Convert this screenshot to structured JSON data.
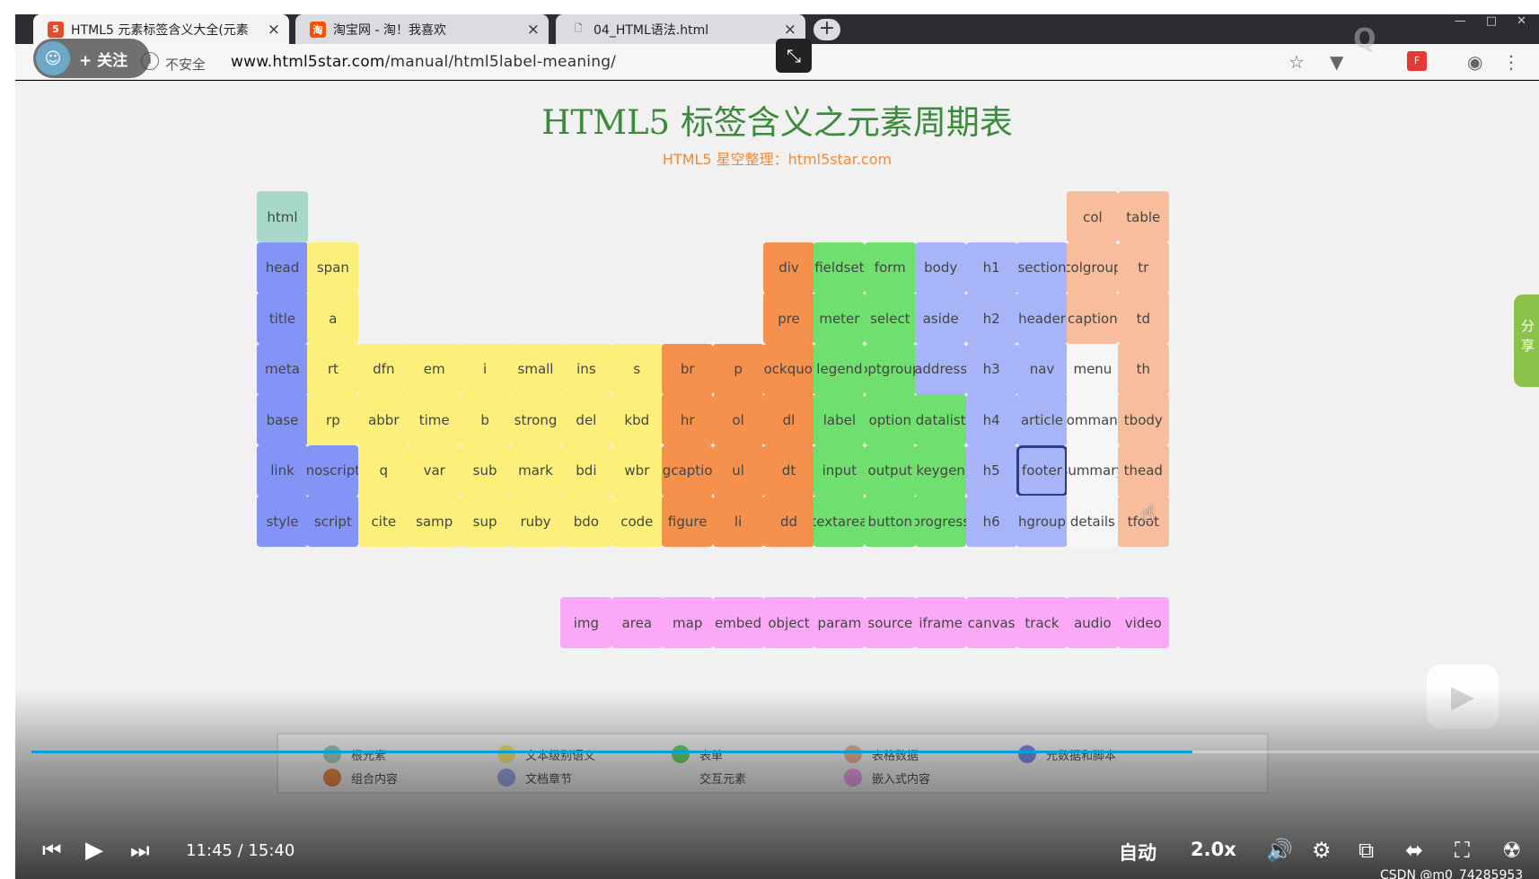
{
  "browser": {
    "tabs": [
      {
        "title": "HTML5 元素标签含义大全(元素",
        "favicon": "5"
      },
      {
        "title": "淘宝网 - 淘！我喜欢",
        "favicon": "淘"
      },
      {
        "title": "04_HTML语法.html",
        "favicon": "🗋"
      }
    ],
    "security_label": "不安全",
    "url_host": "www.html5star.com",
    "url_path": "/manual/html5label-meaning/"
  },
  "overlay": {
    "follow_label": "+ 关注"
  },
  "page": {
    "title": "HTML5 标签含义之元素周期表",
    "subtitle": "HTML5 星空整理：html5star.com"
  },
  "categories": {
    "root": {
      "name": "根元素",
      "color": "#a8d8c8"
    },
    "group": {
      "name": "组合内容",
      "color": "#f6914d"
    },
    "text": {
      "name": "文本级别语义",
      "color": "#fdf07a"
    },
    "section": {
      "name": "文档章节",
      "color": "#a7b4f7"
    },
    "form": {
      "name": "表单",
      "color": "#6fe06f"
    },
    "interactive": {
      "name": "交互元素",
      "color": "#f6f6f6"
    },
    "table": {
      "name": "表格数据",
      "color": "#f7bd9c"
    },
    "embed": {
      "name": "嵌入式内容",
      "color": "#fba9f7"
    },
    "meta": {
      "name": "元数据和脚本",
      "color": "#8493f6"
    }
  },
  "elements": [
    {
      "tag": "html",
      "cat": "root"
    },
    {
      "tag": "col",
      "cat": "table"
    },
    {
      "tag": "table",
      "cat": "table"
    },
    {
      "tag": "head",
      "cat": "meta"
    },
    {
      "tag": "span",
      "cat": "text"
    },
    {
      "tag": "div",
      "cat": "group"
    },
    {
      "tag": "fieldset",
      "cat": "form"
    },
    {
      "tag": "form",
      "cat": "form"
    },
    {
      "tag": "body",
      "cat": "section"
    },
    {
      "tag": "h1",
      "cat": "section"
    },
    {
      "tag": "section",
      "cat": "section"
    },
    {
      "tag": "colgroup",
      "cat": "table"
    },
    {
      "tag": "tr",
      "cat": "table"
    },
    {
      "tag": "title",
      "cat": "meta"
    },
    {
      "tag": "a",
      "cat": "text"
    },
    {
      "tag": "pre",
      "cat": "group"
    },
    {
      "tag": "meter",
      "cat": "form"
    },
    {
      "tag": "select",
      "cat": "form"
    },
    {
      "tag": "aside",
      "cat": "section"
    },
    {
      "tag": "h2",
      "cat": "section"
    },
    {
      "tag": "header",
      "cat": "section"
    },
    {
      "tag": "caption",
      "cat": "table"
    },
    {
      "tag": "td",
      "cat": "table"
    },
    {
      "tag": "meta",
      "cat": "meta"
    },
    {
      "tag": "rt",
      "cat": "text"
    },
    {
      "tag": "dfn",
      "cat": "text"
    },
    {
      "tag": "em",
      "cat": "text"
    },
    {
      "tag": "i",
      "cat": "text"
    },
    {
      "tag": "small",
      "cat": "text"
    },
    {
      "tag": "ins",
      "cat": "text"
    },
    {
      "tag": "s",
      "cat": "text"
    },
    {
      "tag": "br",
      "cat": "group"
    },
    {
      "tag": "p",
      "cat": "group"
    },
    {
      "tag": "blockquote",
      "cat": "group"
    },
    {
      "tag": "legend",
      "cat": "form"
    },
    {
      "tag": "optgroup",
      "cat": "form"
    },
    {
      "tag": "address",
      "cat": "section"
    },
    {
      "tag": "h3",
      "cat": "section"
    },
    {
      "tag": "nav",
      "cat": "section"
    },
    {
      "tag": "menu",
      "cat": "interactive"
    },
    {
      "tag": "th",
      "cat": "table"
    },
    {
      "tag": "base",
      "cat": "meta"
    },
    {
      "tag": "rp",
      "cat": "text"
    },
    {
      "tag": "abbr",
      "cat": "text"
    },
    {
      "tag": "time",
      "cat": "text"
    },
    {
      "tag": "b",
      "cat": "text"
    },
    {
      "tag": "strong",
      "cat": "text"
    },
    {
      "tag": "del",
      "cat": "text"
    },
    {
      "tag": "kbd",
      "cat": "text"
    },
    {
      "tag": "hr",
      "cat": "group"
    },
    {
      "tag": "ol",
      "cat": "group"
    },
    {
      "tag": "dl",
      "cat": "group"
    },
    {
      "tag": "label",
      "cat": "form"
    },
    {
      "tag": "option",
      "cat": "form"
    },
    {
      "tag": "datalist",
      "cat": "form"
    },
    {
      "tag": "h4",
      "cat": "section"
    },
    {
      "tag": "article",
      "cat": "section"
    },
    {
      "tag": "command",
      "cat": "interactive"
    },
    {
      "tag": "tbody",
      "cat": "table"
    },
    {
      "tag": "link",
      "cat": "meta"
    },
    {
      "tag": "noscript",
      "cat": "meta"
    },
    {
      "tag": "q",
      "cat": "text"
    },
    {
      "tag": "var",
      "cat": "text"
    },
    {
      "tag": "sub",
      "cat": "text"
    },
    {
      "tag": "mark",
      "cat": "text"
    },
    {
      "tag": "bdi",
      "cat": "text"
    },
    {
      "tag": "wbr",
      "cat": "text"
    },
    {
      "tag": "figcaption",
      "cat": "group"
    },
    {
      "tag": "ul",
      "cat": "group"
    },
    {
      "tag": "dt",
      "cat": "group"
    },
    {
      "tag": "input",
      "cat": "form"
    },
    {
      "tag": "output",
      "cat": "form"
    },
    {
      "tag": "keygen",
      "cat": "form"
    },
    {
      "tag": "h5",
      "cat": "section"
    },
    {
      "tag": "footer",
      "cat": "section",
      "highlight": true
    },
    {
      "tag": "summary",
      "cat": "interactive"
    },
    {
      "tag": "thead",
      "cat": "table"
    },
    {
      "tag": "style",
      "cat": "meta"
    },
    {
      "tag": "script",
      "cat": "meta"
    },
    {
      "tag": "cite",
      "cat": "text"
    },
    {
      "tag": "samp",
      "cat": "text"
    },
    {
      "tag": "sup",
      "cat": "text"
    },
    {
      "tag": "ruby",
      "cat": "text"
    },
    {
      "tag": "bdo",
      "cat": "text"
    },
    {
      "tag": "code",
      "cat": "text"
    },
    {
      "tag": "figure",
      "cat": "group"
    },
    {
      "tag": "li",
      "cat": "group"
    },
    {
      "tag": "dd",
      "cat": "group"
    },
    {
      "tag": "textarea",
      "cat": "form"
    },
    {
      "tag": "button",
      "cat": "form"
    },
    {
      "tag": "progress",
      "cat": "form"
    },
    {
      "tag": "h6",
      "cat": "section"
    },
    {
      "tag": "hgroup",
      "cat": "section"
    },
    {
      "tag": "details",
      "cat": "interactive"
    },
    {
      "tag": "tfoot",
      "cat": "table"
    },
    {
      "tag": "img",
      "cat": "embed"
    },
    {
      "tag": "area",
      "cat": "embed"
    },
    {
      "tag": "map",
      "cat": "embed"
    },
    {
      "tag": "embed",
      "cat": "embed"
    },
    {
      "tag": "object",
      "cat": "embed"
    },
    {
      "tag": "param",
      "cat": "embed"
    },
    {
      "tag": "source",
      "cat": "embed"
    },
    {
      "tag": "iframe",
      "cat": "embed"
    },
    {
      "tag": "canvas",
      "cat": "embed"
    },
    {
      "tag": "track",
      "cat": "embed"
    },
    {
      "tag": "audio",
      "cat": "embed"
    },
    {
      "tag": "video",
      "cat": "embed"
    }
  ],
  "legend": [
    {
      "cat": "root"
    },
    {
      "cat": "group"
    },
    {
      "cat": "text"
    },
    {
      "cat": "section"
    },
    {
      "cat": "form"
    },
    {
      "cat": "interactive"
    },
    {
      "cat": "table"
    },
    {
      "cat": "embed"
    },
    {
      "cat": "meta"
    }
  ],
  "side_tab_label": "分享",
  "player": {
    "current_time": "11:45",
    "separator": "/",
    "duration": "15:40",
    "progress": 0.77,
    "quality": "自动",
    "speed": "2.0x",
    "credit": "CSDN @m0_74285953"
  }
}
